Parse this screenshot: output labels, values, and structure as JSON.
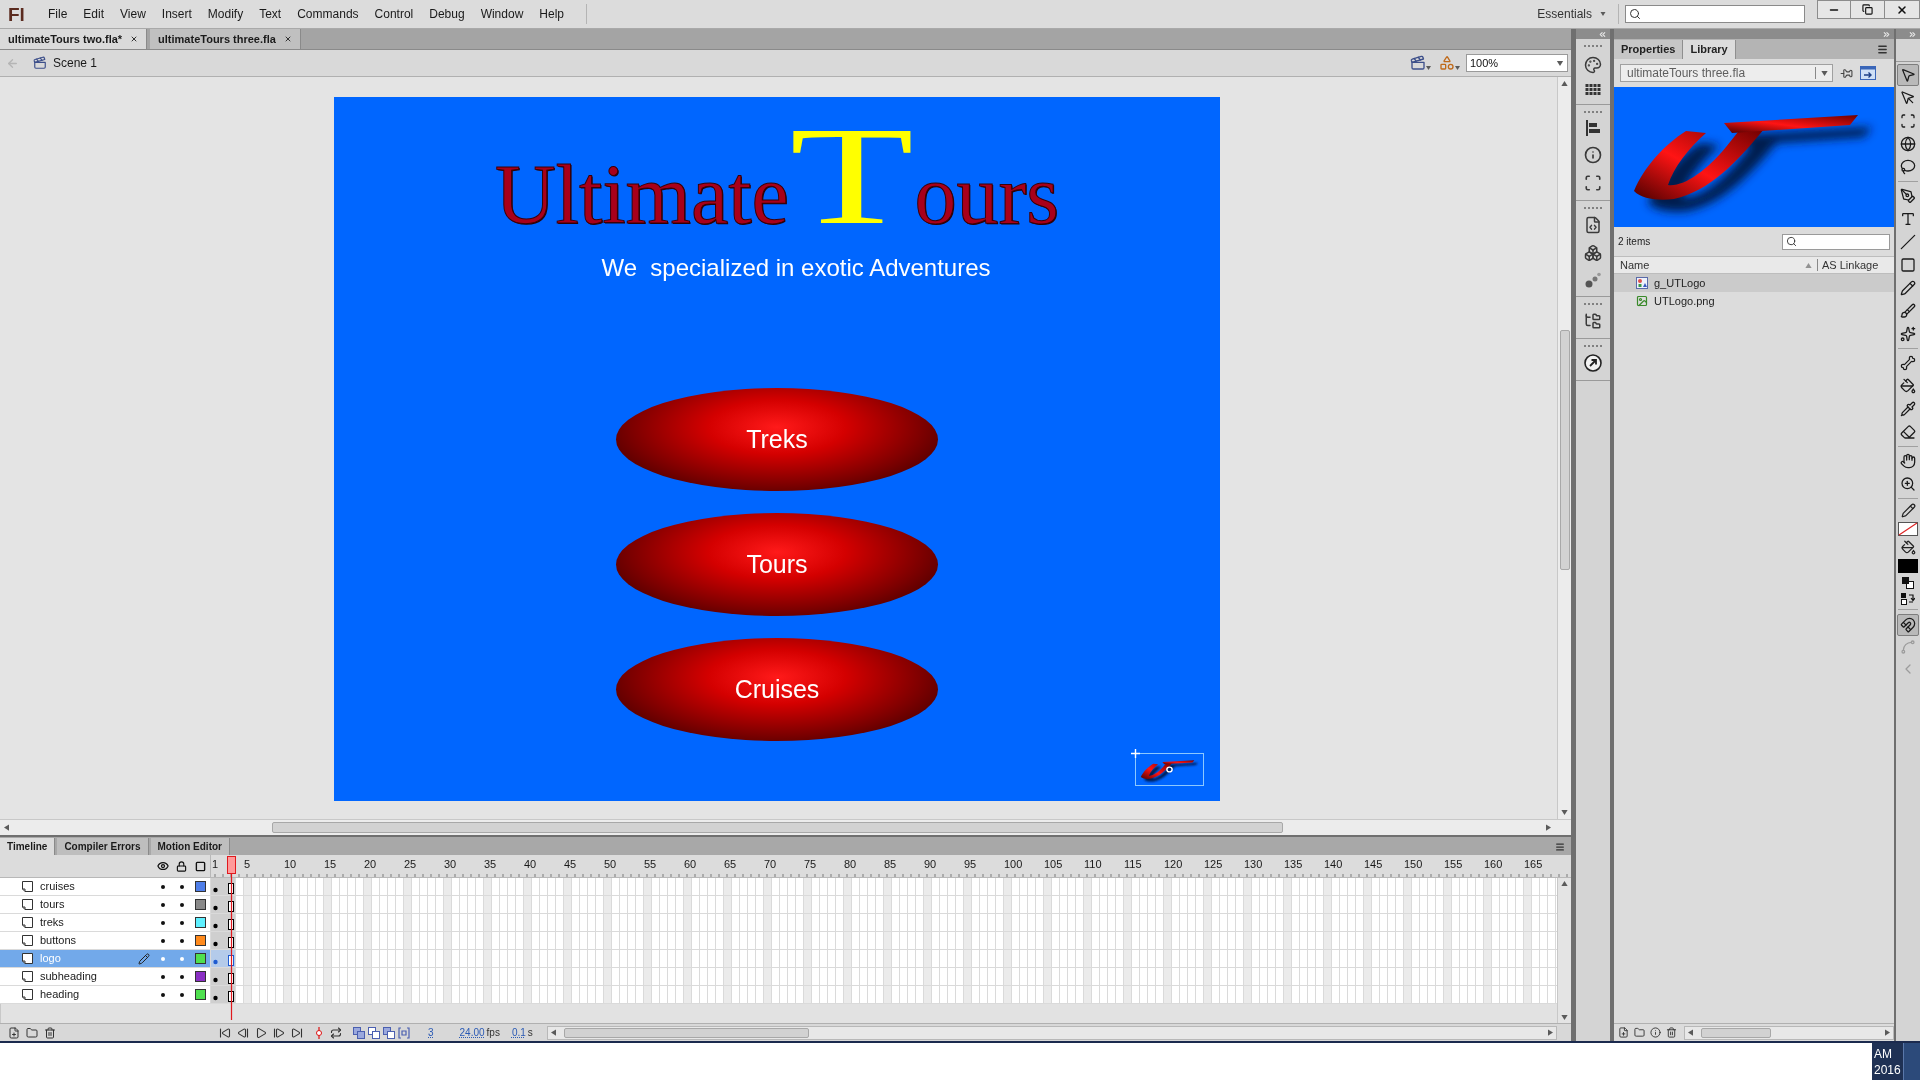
{
  "app": {
    "logo": "Fl"
  },
  "menu": [
    "File",
    "Edit",
    "View",
    "Insert",
    "Modify",
    "Text",
    "Commands",
    "Control",
    "Debug",
    "Window",
    "Help"
  ],
  "workspace": {
    "label": "Essentials"
  },
  "document_tabs": [
    {
      "label": "ultimateTours two.fla*",
      "selected": true
    },
    {
      "label": "ultimateTours three.fla",
      "selected": false
    }
  ],
  "edit_bar": {
    "scene": "Scene 1",
    "zoom": "100%"
  },
  "stage": {
    "title": [
      {
        "text": "Ultimate",
        "kind": "word"
      },
      {
        "text": "T",
        "kind": "initial"
      },
      {
        "text": "ours",
        "kind": "word"
      }
    ],
    "subtitle": "We  specialized in exotic Adventures",
    "buttons": [
      "Treks",
      "Tours",
      "Cruises"
    ],
    "logo": {
      "selected": true
    }
  },
  "timeline": {
    "tabs": [
      {
        "label": "Timeline",
        "selected": true
      },
      {
        "label": "Compiler Errors",
        "selected": false
      },
      {
        "label": "Motion Editor",
        "selected": false
      }
    ],
    "frame_numbers": [
      "1",
      "5",
      "10",
      "15",
      "20",
      "25",
      "30",
      "35",
      "40",
      "45",
      "50",
      "55",
      "60",
      "65",
      "70",
      "75",
      "80",
      "85",
      "90",
      "95",
      "100",
      "105",
      "110",
      "115",
      "120",
      "125",
      "130",
      "135",
      "140",
      "145",
      "150",
      "155",
      "160",
      "165"
    ],
    "layers": [
      {
        "name": "cruises",
        "color": "#4f7ee8",
        "selected": false
      },
      {
        "name": "tours",
        "color": "#8a8a8a",
        "selected": false
      },
      {
        "name": "treks",
        "color": "#5ff0ff",
        "selected": false
      },
      {
        "name": "buttons",
        "color": "#ff8a1c",
        "selected": false
      },
      {
        "name": "logo",
        "color": "#4fe04f",
        "selected": true
      },
      {
        "name": "subheading",
        "color": "#8a2fc4",
        "selected": false
      },
      {
        "name": "heading",
        "color": "#4fe04f",
        "selected": false
      }
    ],
    "current_frame": "3",
    "fps": "24.00",
    "fps_unit": "fps",
    "elapsed": "0.1",
    "elapsed_unit": "s"
  },
  "panel_tabs": [
    {
      "label": "Properties",
      "selected": false
    },
    {
      "label": "Library",
      "selected": true
    }
  ],
  "library": {
    "document": "ultimateTours three.fla",
    "count": "2 items",
    "columns": [
      "Name",
      "AS Linkage"
    ],
    "items": [
      {
        "name": "g_UTLogo",
        "kind": "graphic",
        "selected": true
      },
      {
        "name": "UTLogo.png",
        "kind": "bitmap",
        "selected": false
      }
    ]
  },
  "tools": [
    {
      "selected": true
    },
    {
      "selected": false
    },
    {
      "selected": false
    },
    {
      "selected": false
    },
    {
      "selected": false
    },
    {
      "selected": false
    },
    {
      "selected": false
    },
    {
      "selected": false
    },
    {
      "selected": false
    },
    {
      "selected": false
    },
    {
      "selected": false
    },
    {
      "selected": false
    },
    {
      "selected": false
    },
    {
      "selected": false
    },
    {
      "selected": false
    },
    {
      "selected": false
    },
    {
      "selected": false
    },
    {
      "selected": false
    }
  ],
  "tool_options": [
    {
      "on": true,
      "disabled": false
    },
    {
      "on": false,
      "disabled": true
    },
    {
      "on": false,
      "disabled": true
    }
  ],
  "taskbar": {
    "time": "AM",
    "date": "2016"
  }
}
